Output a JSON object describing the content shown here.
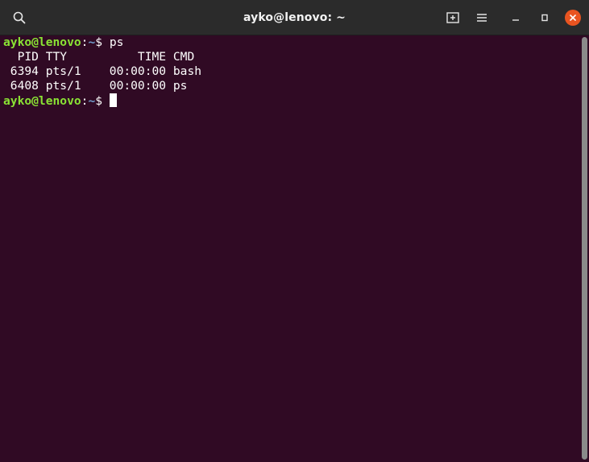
{
  "window": {
    "title": "ayko@lenovo: ~"
  },
  "titlebar": {
    "buttons": [
      {
        "name": "search",
        "icon": "search-icon"
      },
      {
        "name": "new-tab",
        "icon": "new-tab-icon"
      },
      {
        "name": "menu",
        "icon": "hamburger-menu-icon"
      },
      {
        "name": "minimize",
        "icon": "minimize-icon"
      },
      {
        "name": "maximize",
        "icon": "maximize-icon"
      },
      {
        "name": "close",
        "icon": "close-icon"
      }
    ]
  },
  "terminal": {
    "prompt1": {
      "user_host": "ayko@lenovo",
      "colon": ":",
      "path": "~",
      "symbol": "$ ",
      "command": "ps"
    },
    "ps_output": [
      "  PID TTY          TIME CMD",
      " 6394 pts/1    00:00:00 bash",
      " 6408 pts/1    00:00:00 ps"
    ],
    "prompt2": {
      "user_host": "ayko@lenovo",
      "colon": ":",
      "path": "~",
      "symbol": "$ ",
      "command": ""
    }
  },
  "colors": {
    "background": "#300a24",
    "titlebar": "#2b2b2b",
    "prompt_user": "#8ae234",
    "prompt_path": "#729fcf",
    "close_button": "#e95420",
    "text": "#ffffff"
  }
}
